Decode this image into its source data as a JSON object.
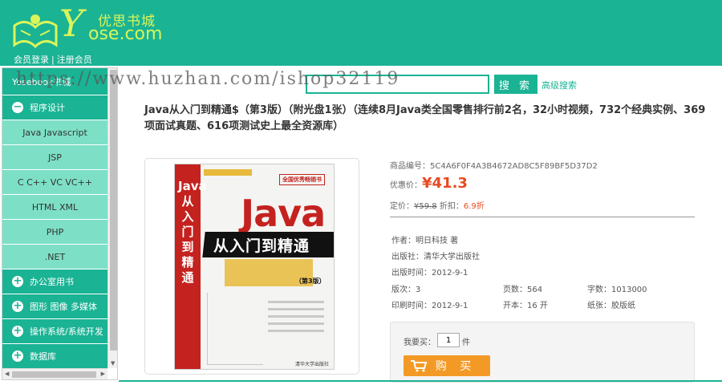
{
  "brand": {
    "name_cn": "优思书城",
    "logo_y": "Y",
    "logo_domain": "ose.com"
  },
  "member": {
    "login": "会员登录",
    "register": "注册会员",
    "sep": "|"
  },
  "watermark": "https://www.huzhan.com/ishop32119",
  "sidebar": {
    "top_category": "Yosebook书城",
    "categories_before": [
      {
        "icon": "minus-icon",
        "label": "程序设计"
      }
    ],
    "items": [
      "Java Javascript",
      "JSP",
      "C C++ VC VC++",
      "HTML XML",
      "PHP",
      ".NET"
    ],
    "categories_after": [
      {
        "icon": "plus-icon",
        "label": "办公室用书"
      },
      {
        "icon": "plus-icon",
        "label": "图形 图像 多媒体"
      },
      {
        "icon": "plus-icon",
        "label": "操作系统/系统开发"
      },
      {
        "icon": "plus-icon",
        "label": "数据库"
      }
    ]
  },
  "search": {
    "value": "",
    "button": "搜 索",
    "advanced": "高级搜索"
  },
  "product": {
    "title": "Java从入门到精通$（第3版）（附光盘1张）（连续8月Java类全国零售排行前2名，32小时视频，732个经典实例、369项面试真题、616项测试史上最全资源库）",
    "cover": {
      "spine": "Java 从入门到精通",
      "badge": "全国优秀畅销书",
      "java": "Java",
      "subtitle": "从入门到精通",
      "edition": "（第3版）",
      "publisher": "清华大学出版社"
    },
    "code_label": "商品编号：",
    "code": "5C4A6F0F4A3B4672AD8C5F89BF5D37D2",
    "price_label": "优惠价：",
    "price": "¥41.3",
    "list_price_label": "定价：",
    "list_price": "¥59.8",
    "discount_label": "折扣：",
    "discount": "6.9折",
    "author_label": "作者：",
    "author": "明日科技 著",
    "publisher_label": "出版社：",
    "publisher": "清华大学出版社",
    "pubdate_label": "出版时间：",
    "pubdate": "2012-9-1",
    "edition_label": "版次：",
    "edition": "3",
    "pages_label": "页数：",
    "pages": "564",
    "words_label": "字数：",
    "words": "1013000",
    "printdate_label": "印刷时间：",
    "printdate": "2012-9-1",
    "format_label": "开本：",
    "format": "16 开",
    "paper_label": "纸张：",
    "paper": "胶版纸"
  },
  "buy": {
    "label": "我要买：",
    "qty": "1",
    "unit": "件",
    "button": "购 买"
  },
  "colors": {
    "brand": "#1ab394",
    "sidebar_item": "#7de0c6",
    "price": "#e74b22",
    "buy_button": "#f39a26"
  }
}
